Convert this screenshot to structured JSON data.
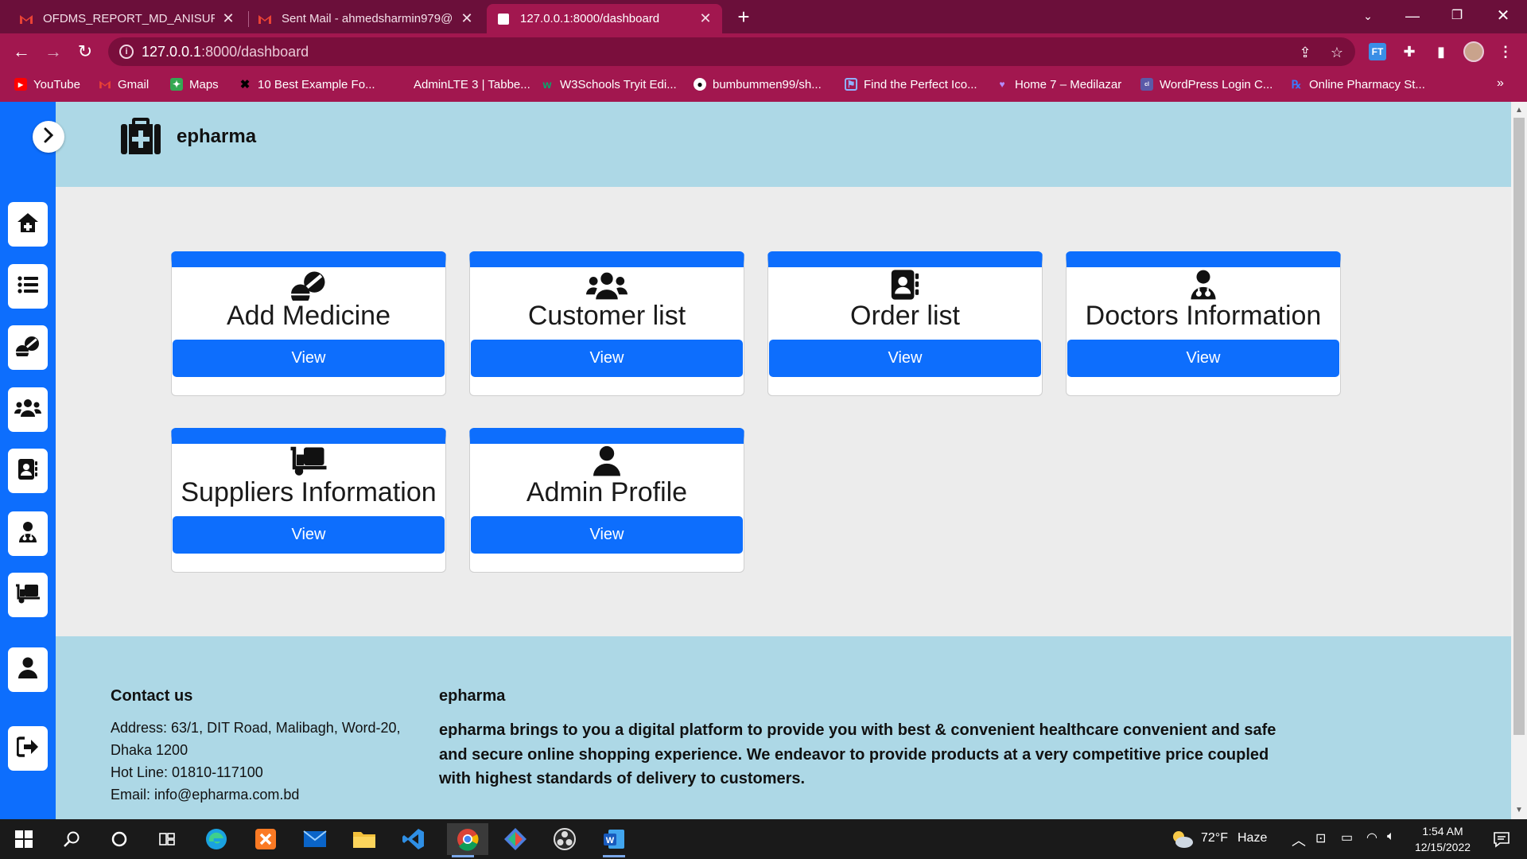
{
  "browser": {
    "tabs": [
      {
        "title": "OFDMS_REPORT_MD_ANISUR_R/",
        "favicon": "gmail-icon"
      },
      {
        "title": "Sent Mail - ahmedsharmin979@",
        "favicon": "gmail-icon"
      },
      {
        "title": "127.0.0.1:8000/dashboard",
        "favicon": "page-icon"
      }
    ],
    "address": {
      "host": "127.0.0.1",
      "path": ":8000/dashboard"
    },
    "bookmarks": [
      {
        "label": "YouTube"
      },
      {
        "label": "Gmail"
      },
      {
        "label": "Maps"
      },
      {
        "label": "10 Best Example Fo..."
      },
      {
        "label": "AdminLTE 3 | Tabbe..."
      },
      {
        "label": "W3Schools Tryit Edi..."
      },
      {
        "label": "bumbummen99/sh..."
      },
      {
        "label": "Find the Perfect Ico..."
      },
      {
        "label": "Home 7 – Medilazar"
      },
      {
        "label": "WordPress Login C..."
      },
      {
        "label": "Online Pharmacy St..."
      }
    ],
    "extension_label": "FT",
    "more_bookmarks": "»"
  },
  "brand": {
    "name": "epharma"
  },
  "sidebar": {
    "items": [
      {
        "icon": "home-medical-icon"
      },
      {
        "icon": "list-icon"
      },
      {
        "icon": "pills-icon"
      },
      {
        "icon": "users-icon"
      },
      {
        "icon": "address-book-icon"
      },
      {
        "icon": "doctor-icon"
      },
      {
        "icon": "dolly-icon"
      },
      {
        "icon": "user-icon"
      },
      {
        "icon": "sign-out-icon"
      }
    ]
  },
  "cards": [
    {
      "title": "Add Medicine",
      "button": "View",
      "icon": "pills-icon"
    },
    {
      "title": "Customer list",
      "button": "View",
      "icon": "users-icon"
    },
    {
      "title": "Order list",
      "button": "View",
      "icon": "address-book-icon"
    },
    {
      "title": "Doctors Information",
      "button": "View",
      "icon": "doctor-icon"
    },
    {
      "title": "Suppliers Information",
      "button": "View",
      "icon": "dolly-icon"
    },
    {
      "title": "Admin Profile",
      "button": "View",
      "icon": "user-icon"
    }
  ],
  "footer": {
    "contact_heading": "Contact us",
    "address_line1": "Address: 63/1, DIT Road, Malibagh, Word-20,",
    "address_line2": "Dhaka 1200",
    "hotline": "Hot Line: 01810-117100",
    "email": "Email: info@epharma.com.bd",
    "about_heading": "epharma",
    "about_text": "epharma brings to you a digital platform to provide you with best & convenient healthcare convenient and safe and secure online shopping experience. We endeavor to provide products at a very competitive price coupled with highest standards of delivery to customers."
  },
  "taskbar": {
    "weather": {
      "temp": "72°F",
      "condition": "Haze"
    },
    "clock": {
      "time": "1:54 AM",
      "date": "12/15/2022"
    }
  },
  "colors": {
    "chrome_frame": "#6b0f3a",
    "chrome_toolbar": "#a2174f",
    "primary": "#0d6efd",
    "header_footer": "#add8e6",
    "page_bg": "#ececec"
  }
}
